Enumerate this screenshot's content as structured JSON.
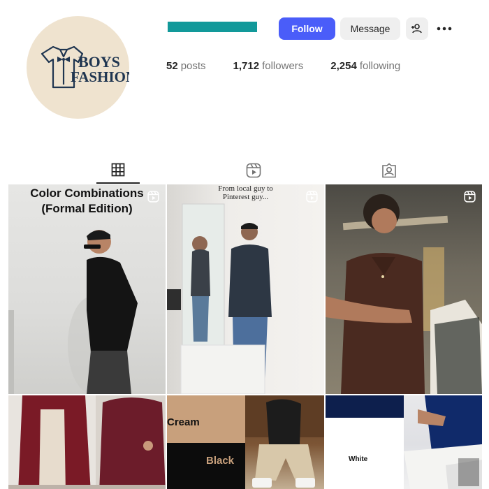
{
  "profile": {
    "avatar_text_line1": "BOYS",
    "avatar_text_line2": "FASHION",
    "avatar_icon": "shirt-bowtie-icon",
    "name_bar_color": "#12999a"
  },
  "actions": {
    "follow_label": "Follow",
    "message_label": "Message",
    "add_user_icon": "add-user-icon",
    "more_icon": "more-horizontal-icon",
    "follow_color": "#4a5df9"
  },
  "stats": {
    "posts_count": "52",
    "posts_label": "posts",
    "followers_count": "1,712",
    "followers_label": "followers",
    "following_count": "2,254",
    "following_label": "following"
  },
  "tabs": [
    {
      "icon": "grid-icon",
      "active": true
    },
    {
      "icon": "reels-icon",
      "active": false
    },
    {
      "icon": "tagged-icon",
      "active": false
    }
  ],
  "posts": [
    {
      "caption": "Color Combinations",
      "caption2": "(Formal Edition)",
      "type": "reel"
    },
    {
      "caption": "From local guy to",
      "caption2": "Pinterest guy...",
      "type": "reel"
    },
    {
      "type": "reel"
    },
    {
      "type": "image"
    },
    {
      "label_top": "Cream",
      "label_bottom": "Black",
      "type": "image"
    },
    {
      "label": "White",
      "type": "image"
    }
  ]
}
